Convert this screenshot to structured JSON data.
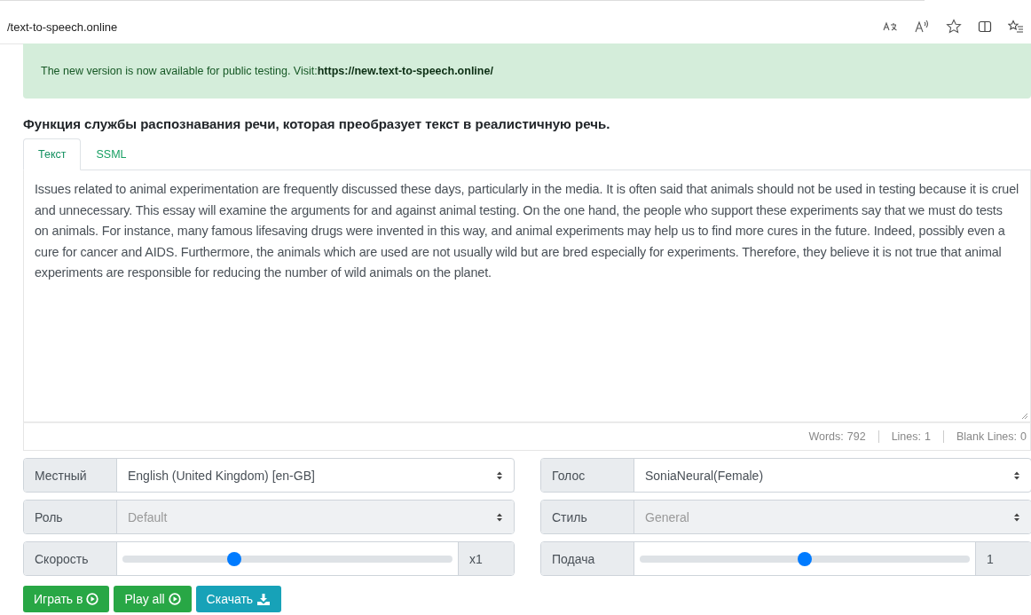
{
  "browser": {
    "url": "/text-to-speech.online"
  },
  "notice": {
    "text": "The new version is now available for public testing. Visit:**https://new.text-to-speech.online/**"
  },
  "heading": "Функция службы распознавания речи, которая преобразует текст в реалистичную речь.",
  "tabs": [
    {
      "label": "Текст",
      "selected": true
    },
    {
      "label": "SSML",
      "selected": false
    }
  ],
  "editor": {
    "value": "Issues related to animal experimentation are frequently discussed these days, particularly in the media. It is often said that animals should not be used in testing because it is cruel and unnecessary. This essay will examine the arguments for and against animal testing. On the one hand, the people who support these experiments say that we must do tests on animals. For instance, many famous lifesaving drugs were invented in this way, and animal experiments may help us to find more cures in the future. Indeed, possibly even a cure for cancer and AIDS. Furthermore, the animals which are used are not usually wild but are bred especially for experiments. Therefore, they believe it is not true that animal experiments are responsible for reducing the number of wild animals on the planet.",
    "stats": [
      {
        "label": "Words:",
        "value": "792"
      },
      {
        "label": "Lines:",
        "value": "1"
      },
      {
        "label": "Blank Lines:",
        "value": "0"
      }
    ]
  },
  "controls": [
    {
      "kind": "select",
      "label": "Местный",
      "value": "English (United Kingdom) [en-GB]",
      "disabled": false
    },
    {
      "kind": "select",
      "label": "Голос",
      "value": "SoniaNeural(Female)",
      "disabled": false
    },
    {
      "kind": "select",
      "label": "Роль",
      "value": "Default",
      "disabled": true
    },
    {
      "kind": "select",
      "label": "Стиль",
      "value": "General",
      "disabled": true
    },
    {
      "kind": "slider",
      "label": "Скорость",
      "level": 0.34,
      "reading": "x1"
    },
    {
      "kind": "slider",
      "label": "Подача",
      "level": 0.5,
      "reading": "1"
    }
  ],
  "buttons": [
    {
      "kind": "play",
      "label": "Играть в"
    },
    {
      "kind": "play",
      "label": "Play all"
    },
    {
      "kind": "download",
      "label": "Скачать"
    }
  ]
}
